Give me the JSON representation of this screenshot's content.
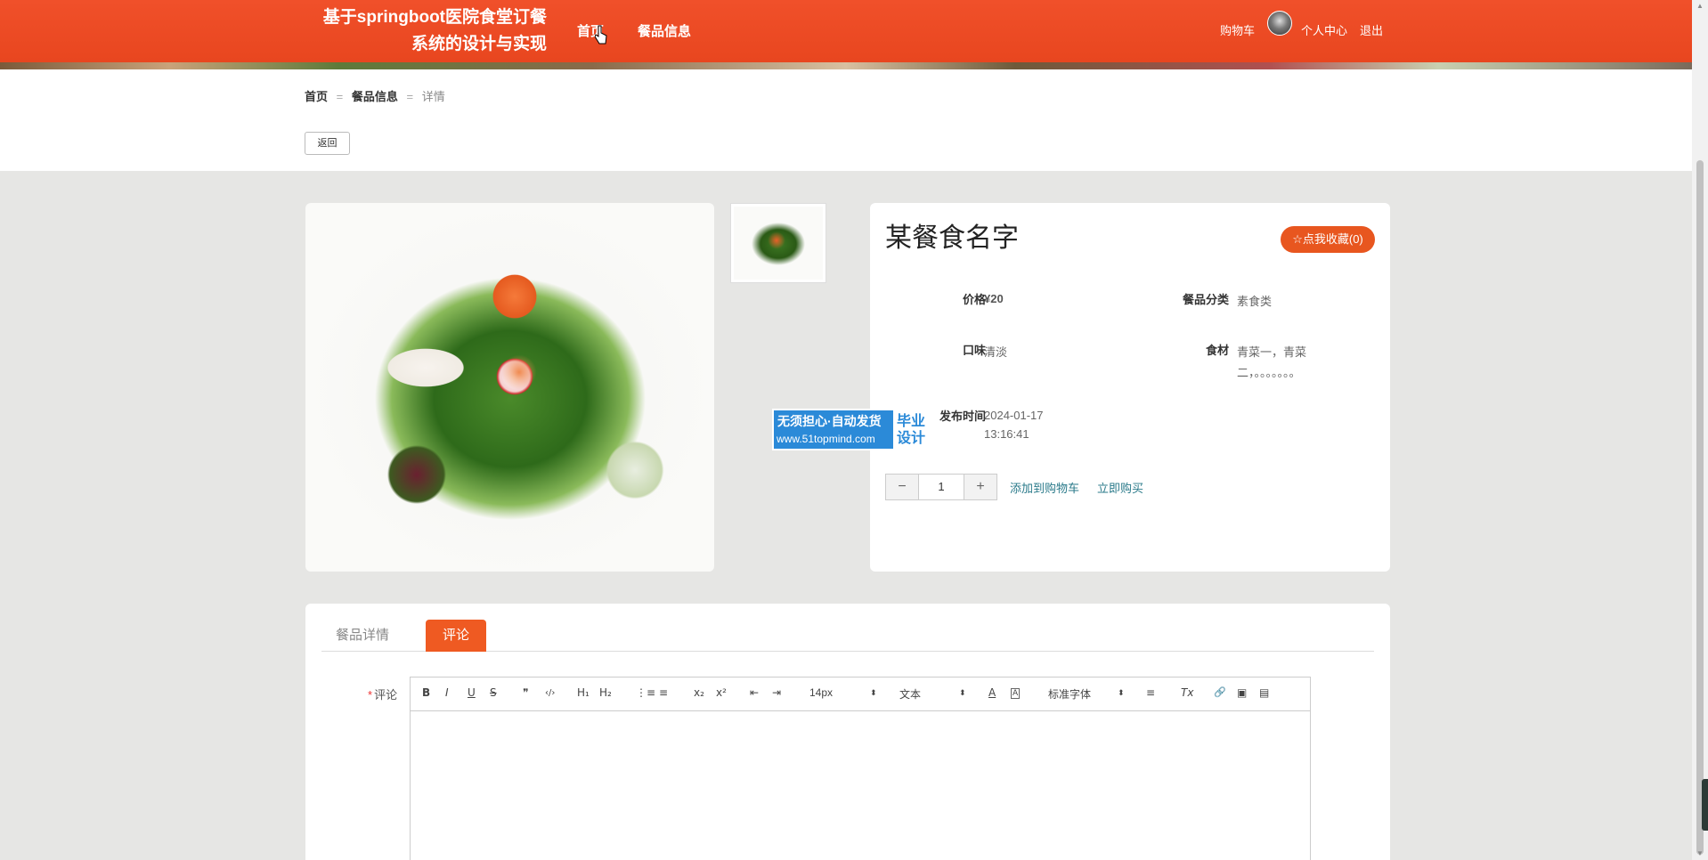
{
  "header": {
    "title_line1": "基于springboot医院食堂订餐",
    "title_line2": "系统的设计与实现",
    "nav": [
      {
        "label": "首页"
      },
      {
        "label": "餐品信息"
      }
    ],
    "cart": "购物车",
    "profile": "个人中心",
    "logout": "退出"
  },
  "breadcrumb": {
    "home": "首页",
    "sep": "=",
    "category": "餐品信息",
    "current": "详情"
  },
  "back_button": "返回",
  "product": {
    "name": "某餐食名字",
    "favorite_label": "☆点我收藏(0)",
    "price_label": "价格",
    "price": "¥20",
    "category_label": "餐品分类",
    "category": "素食类",
    "taste_label": "口味",
    "taste": "清淡",
    "ingredients_label": "食材",
    "ingredients_line1": "青菜一，青菜",
    "ingredients_line2": "二，。。。。。。。",
    "time_label": "发布时间",
    "time_line1": "2024-01-17",
    "time_line2": "13:16:41",
    "quantity": "1",
    "minus": "−",
    "plus": "+",
    "add_to_cart": "添加到购物车",
    "buy_now": "立即购买"
  },
  "watermark": {
    "line1": "无须担心·自动发货",
    "url": "www.51topmind.com",
    "right_line1": "毕业",
    "right_line2": "设计"
  },
  "tabs": [
    {
      "label": "餐品详情",
      "active": false
    },
    {
      "label": "评论",
      "active": true
    }
  ],
  "comment": {
    "required_mark": "*",
    "label": "评论"
  },
  "editor_toolbar": {
    "bold": "B",
    "italic": "I",
    "underline": "U",
    "strike": "S",
    "quote": "❞",
    "code": "‹/›",
    "h1": "H₁",
    "h2": "H₂",
    "ordered_list": "⋮≡",
    "bullet_list": "≡",
    "subscript": "x₂",
    "superscript": "x²",
    "outdent": "⇤",
    "indent": "⇥",
    "font_size": "14px",
    "text_type": "文本",
    "font_color": "A",
    "bg_color": "A",
    "font_family": "标准字体",
    "align": "≡",
    "clear_format": "Tx",
    "link": "🔗",
    "image": "▣",
    "video": "▤",
    "select_arrow": "⬍"
  },
  "colors": {
    "header_bg": "#e8461f",
    "accent": "#ef5a22",
    "link": "#2a7a8a",
    "watermark": "#2b8ad8"
  }
}
